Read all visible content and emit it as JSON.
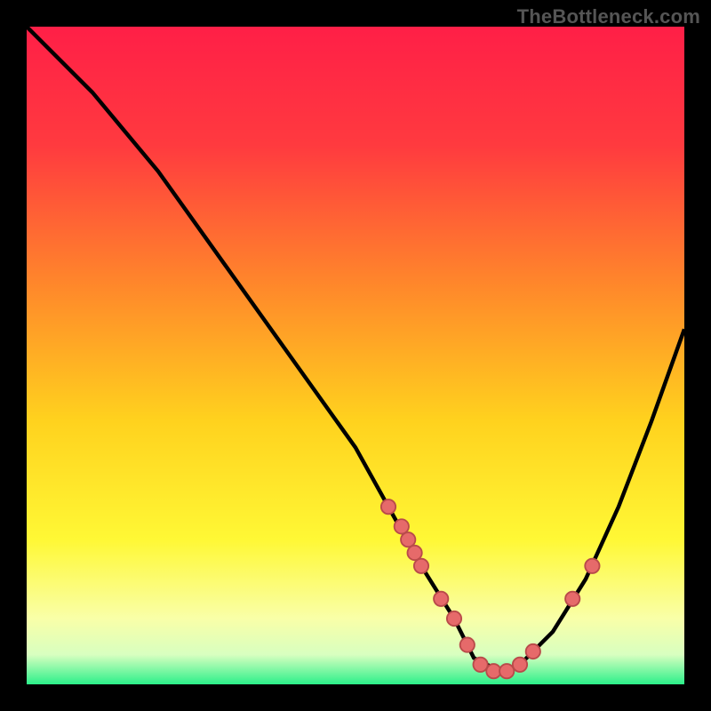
{
  "source_label": "TheBottleneck.com",
  "colors": {
    "frame": "#000000",
    "curve": "#000000",
    "marker_fill": "#e66a6a",
    "marker_stroke": "#b94a4a",
    "gradient_stops": [
      {
        "offset": 0.0,
        "color": "#ff1f47"
      },
      {
        "offset": 0.18,
        "color": "#ff3a3f"
      },
      {
        "offset": 0.4,
        "color": "#ff8a2a"
      },
      {
        "offset": 0.6,
        "color": "#ffd21e"
      },
      {
        "offset": 0.78,
        "color": "#fff835"
      },
      {
        "offset": 0.9,
        "color": "#f9ffa8"
      },
      {
        "offset": 0.955,
        "color": "#d8ffc0"
      },
      {
        "offset": 1.0,
        "color": "#2cf08a"
      }
    ]
  },
  "chart_data": {
    "type": "line",
    "title": "",
    "xlabel": "",
    "ylabel": "",
    "xlim": [
      0,
      100
    ],
    "ylim": [
      0,
      100
    ],
    "series": [
      {
        "name": "bottleneck-curve",
        "x": [
          0,
          10,
          20,
          30,
          40,
          50,
          55,
          60,
          65,
          68,
          72,
          75,
          80,
          85,
          90,
          95,
          100
        ],
        "values": [
          100,
          90,
          78,
          64,
          50,
          36,
          27,
          18,
          10,
          4,
          2,
          3,
          8,
          16,
          27,
          40,
          54
        ]
      }
    ],
    "markers": {
      "name": "highlight-points",
      "x": [
        55,
        57,
        58,
        59,
        60,
        63,
        65,
        67,
        69,
        71,
        73,
        75,
        77,
        83,
        86
      ],
      "values": [
        27,
        24,
        22,
        20,
        18,
        13,
        10,
        6,
        3,
        2,
        2,
        3,
        5,
        13,
        18
      ]
    }
  }
}
